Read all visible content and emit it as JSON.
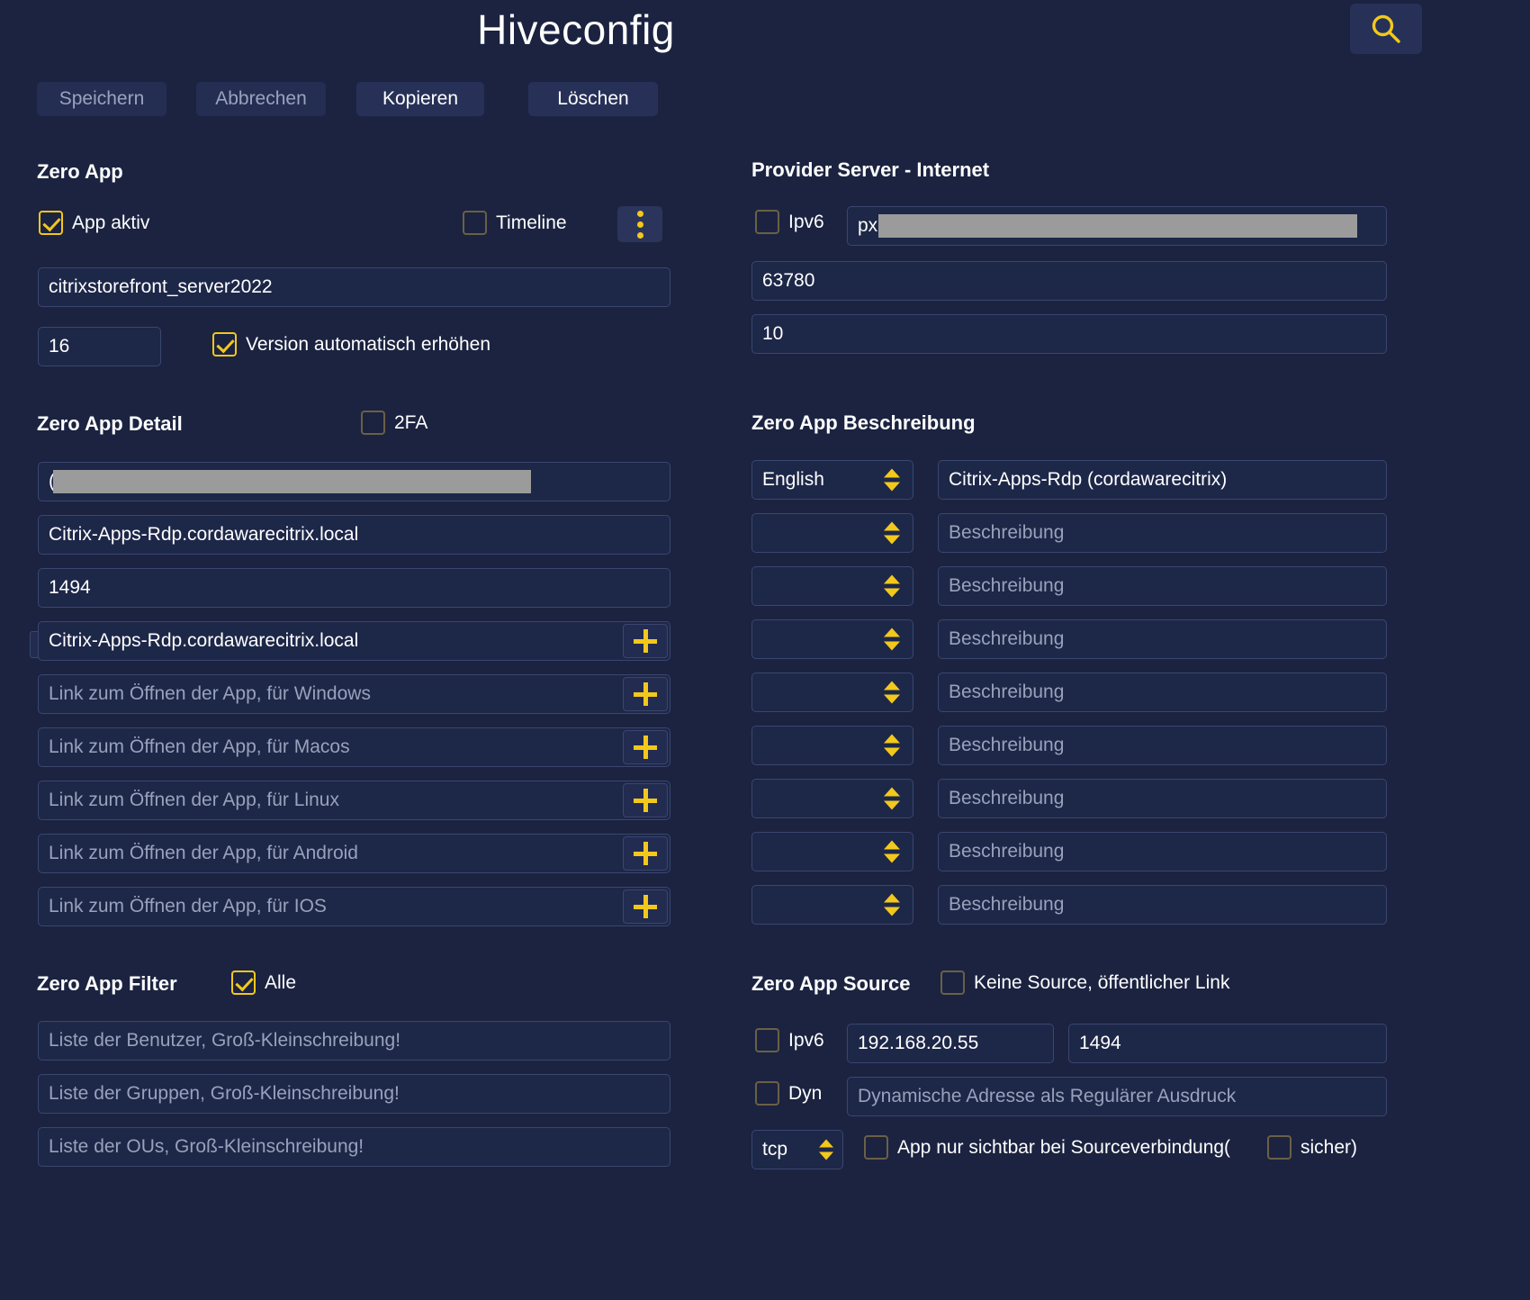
{
  "header": {
    "title": "Hiveconfig",
    "search_icon": "search-icon"
  },
  "toolbar": {
    "buttons": [
      {
        "label": "Speichern",
        "state": "disabled"
      },
      {
        "label": "Abbrechen",
        "state": "disabled"
      },
      {
        "label": "Kopieren",
        "state": "enabled"
      },
      {
        "label": "Löschen",
        "state": "enabled"
      }
    ]
  },
  "zero_app": {
    "heading": "Zero App",
    "app_aktiv": {
      "label": "App aktiv",
      "checked": true
    },
    "timeline": {
      "label": "Timeline",
      "checked": false
    },
    "menu_icon": "kebab-menu-icon",
    "name_value": "citrixstorefront_server2022",
    "version_value": "16",
    "version_auto": {
      "label": "Version automatisch erhöhen",
      "checked": true
    }
  },
  "provider_server": {
    "heading": "Provider Server - Internet",
    "ipv6": {
      "label": "Ipv6",
      "checked": false
    },
    "host_prefix": "px",
    "host_masked": true,
    "port_value": "63780",
    "count_value": "10"
  },
  "zero_app_detail": {
    "heading": "Zero App Detail",
    "twofa": {
      "label": "2FA",
      "checked": false
    },
    "id_prefix": "(",
    "id_masked": true,
    "host_value": "Citrix-Apps-Rdp.cordawarecitrix.local",
    "port_value": "1494",
    "links": [
      {
        "value": "Citrix-Apps-Rdp.cordawarecitrix.local",
        "placeholder": "",
        "has_plus": true
      },
      {
        "value": "",
        "placeholder": "Link zum Öffnen der App, für Windows",
        "has_plus": true
      },
      {
        "value": "",
        "placeholder": "Link zum Öffnen der App, für Macos",
        "has_plus": true
      },
      {
        "value": "",
        "placeholder": "Link zum Öffnen der App, für Linux",
        "has_plus": true
      },
      {
        "value": "",
        "placeholder": "Link zum Öffnen der App, für Android",
        "has_plus": true
      },
      {
        "value": "",
        "placeholder": "Link zum Öffnen der App, für IOS",
        "has_plus": true
      }
    ]
  },
  "zero_app_beschreibung": {
    "heading": "Zero App Beschreibung",
    "rows": [
      {
        "language": "English",
        "description": "Citrix-Apps-Rdp (cordawarecitrix)",
        "placeholder": "Beschreibung"
      },
      {
        "language": "",
        "description": "",
        "placeholder": "Beschreibung"
      },
      {
        "language": "",
        "description": "",
        "placeholder": "Beschreibung"
      },
      {
        "language": "",
        "description": "",
        "placeholder": "Beschreibung"
      },
      {
        "language": "",
        "description": "",
        "placeholder": "Beschreibung"
      },
      {
        "language": "",
        "description": "",
        "placeholder": "Beschreibung"
      },
      {
        "language": "",
        "description": "",
        "placeholder": "Beschreibung"
      },
      {
        "language": "",
        "description": "",
        "placeholder": "Beschreibung"
      },
      {
        "language": "",
        "description": "",
        "placeholder": "Beschreibung"
      }
    ]
  },
  "zero_app_filter": {
    "heading": "Zero App Filter",
    "alle": {
      "label": "Alle",
      "checked": true
    },
    "fields": [
      {
        "placeholder": "Liste der Benutzer, Groß-Kleinschreibung!",
        "value": ""
      },
      {
        "placeholder": "Liste der Gruppen, Groß-Kleinschreibung!",
        "value": ""
      },
      {
        "placeholder": "Liste der OUs, Groß-Kleinschreibung!",
        "value": ""
      }
    ]
  },
  "zero_app_source": {
    "heading": "Zero App Source",
    "keine_source": {
      "label": "Keine Source, öffentlicher Link",
      "checked": false
    },
    "ipv6": {
      "label": "Ipv6",
      "checked": false
    },
    "address_value": "192.168.20.55",
    "port_value": "1494",
    "dyn": {
      "label": "Dyn",
      "checked": false
    },
    "dyn_placeholder": "Dynamische Adresse als Regulärer Ausdruck",
    "protocol": "tcp",
    "visible_only": {
      "label": "App nur sichtbar bei Sourceverbindung(",
      "checked": false
    },
    "secure": {
      "label": "sicher)",
      "checked": false
    }
  },
  "colors": {
    "background": "#1b2340",
    "accent": "#f3c81c",
    "field_bg": "#1d2748",
    "field_border": "#3b4670",
    "button_bg": "#273158",
    "text": "#ffffff",
    "placeholder": "#98a2bb",
    "mask": "#9b9b9b"
  }
}
